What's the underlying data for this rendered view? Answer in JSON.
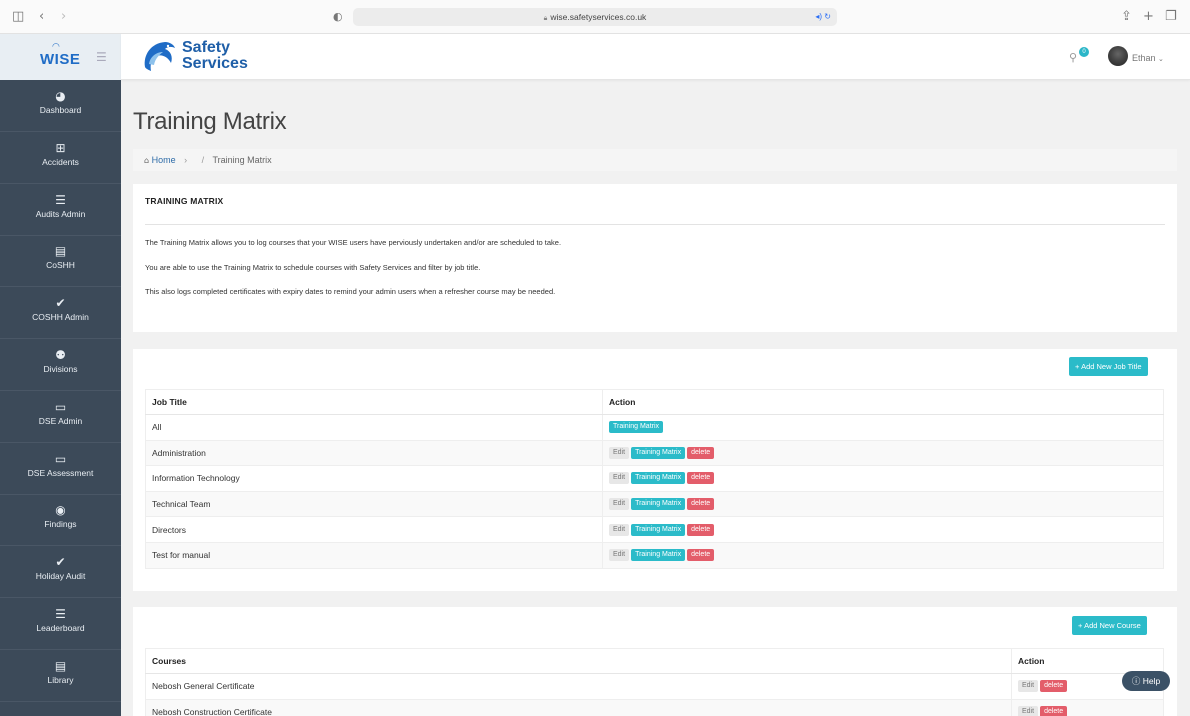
{
  "browser": {
    "url": "wise.safetyservices.co.uk",
    "icons": {
      "sidebar_toggle": "sidebar-icon",
      "back": "back-icon",
      "forward": "forward-icon",
      "shield": "shield-icon",
      "share": "share-icon",
      "new_tab": "plus-icon",
      "tabs": "tabs-icon"
    }
  },
  "brand": {
    "app_logo": "WISE",
    "company_line1": "Safety",
    "company_line2": "Services"
  },
  "topbar": {
    "notification_count": "0",
    "user_name": "Ethan"
  },
  "sidebar": {
    "items": [
      {
        "label": "Dashboard",
        "icon": "dashboard-icon"
      },
      {
        "label": "Accidents",
        "icon": "medkit-icon"
      },
      {
        "label": "Audits Admin",
        "icon": "list-icon"
      },
      {
        "label": "CoSHH",
        "icon": "book-icon"
      },
      {
        "label": "COSHH Admin",
        "icon": "check-icon"
      },
      {
        "label": "Divisions",
        "icon": "users-icon"
      },
      {
        "label": "DSE Admin",
        "icon": "monitor-icon"
      },
      {
        "label": "DSE Assessment",
        "icon": "monitor-icon"
      },
      {
        "label": "Findings",
        "icon": "eye-icon"
      },
      {
        "label": "Holiday Audit",
        "icon": "check-icon"
      },
      {
        "label": "Leaderboard",
        "icon": "list-icon"
      },
      {
        "label": "Library",
        "icon": "book-icon"
      }
    ]
  },
  "page": {
    "title": "Training Matrix",
    "breadcrumb_home": "Home",
    "breadcrumb_current": "Training Matrix"
  },
  "intro": {
    "heading": "TRAINING MATRIX",
    "p1": "The Training Matrix allows you to log courses that your WISE users have perviously undertaken and/or are scheduled to take.",
    "p2": "You are able to use the Training Matrix to schedule courses with Safety Services and filter by job title.",
    "p3": "This also logs completed certificates with expiry dates to remind your admin users when a refresher course may be needed."
  },
  "jobs": {
    "add_button": "Add New Job Title",
    "columns": [
      "Job Title",
      "Action"
    ],
    "rows": [
      {
        "title": "All"
      },
      {
        "title": "Administration"
      },
      {
        "title": "Information Technology"
      },
      {
        "title": "Technical Team"
      },
      {
        "title": "Directors"
      },
      {
        "title": "Test for manual"
      }
    ],
    "edit_label": "Edit",
    "matrix_label": "Training Matrix",
    "delete_label": "delete"
  },
  "courses": {
    "add_button": "Add New Course",
    "columns": [
      "Courses",
      "Action"
    ],
    "rows": [
      {
        "name": "Nebosh General Certificate"
      },
      {
        "name": "Nebosh Construction Certificate"
      }
    ],
    "edit_label": "Edit",
    "delete_label": "delete"
  },
  "help": {
    "label": "Help"
  },
  "colors": {
    "sidebar_bg": "#3c4a59",
    "accent": "#2bbbc9",
    "danger": "#e35d6a",
    "brand_blue": "#1f6cc6"
  }
}
